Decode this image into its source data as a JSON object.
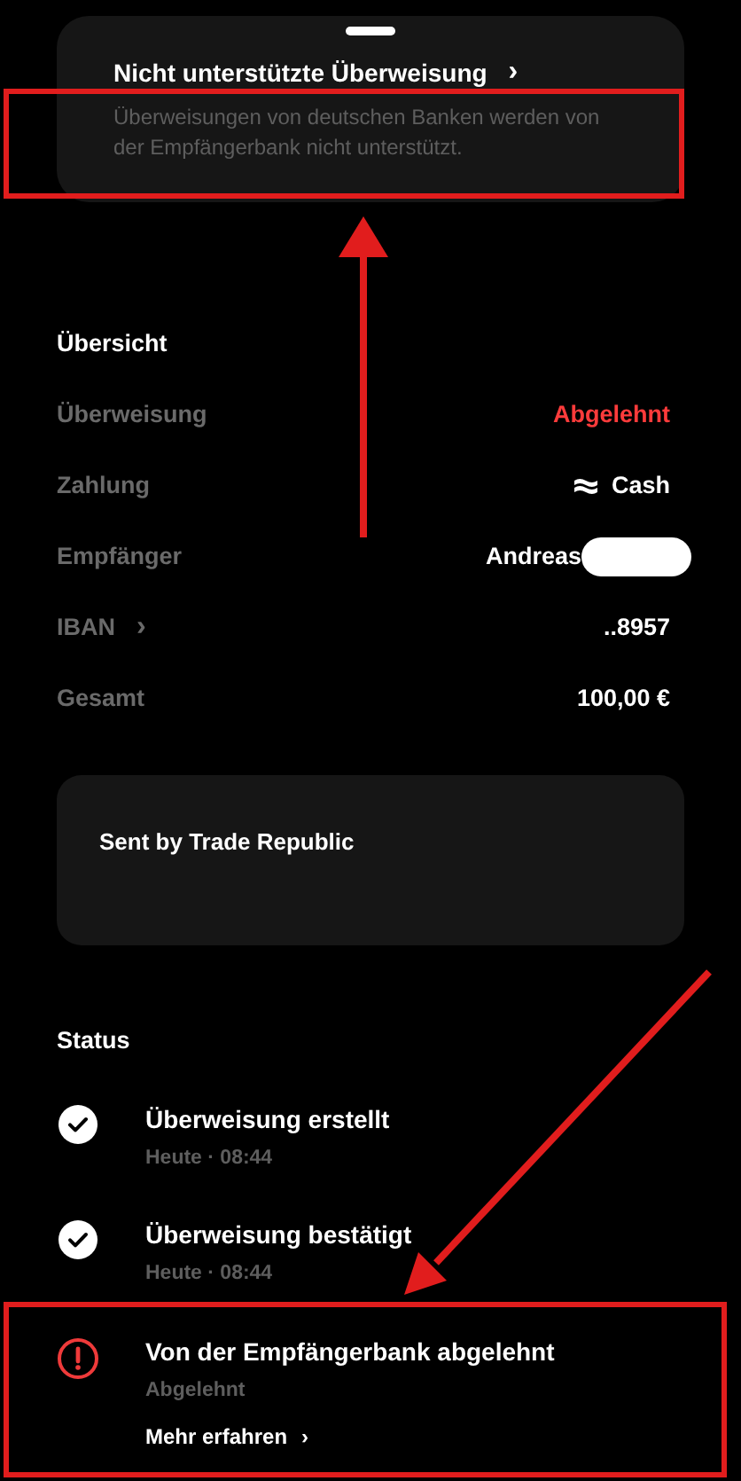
{
  "notice": {
    "title": "Nicht unterstützte Überweisung",
    "chevron": "›",
    "text": "Überweisungen von deutschen Banken werden von der Empfängerbank nicht unterstützt."
  },
  "overview": {
    "heading": "Übersicht",
    "rows": [
      {
        "kind": "status",
        "label": "Überweisung",
        "value": "Abgelehnt"
      },
      {
        "kind": "payment",
        "label": "Zahlung",
        "value": "Cash"
      },
      {
        "kind": "redacted",
        "label": "Empfänger",
        "value": "Andreas"
      },
      {
        "kind": "link",
        "label": "IBAN",
        "chevron": "›",
        "value": "..8957"
      },
      {
        "kind": "plain",
        "label": "Gesamt",
        "value": "100,00 €"
      }
    ]
  },
  "message": {
    "text": "Sent by Trade Republic"
  },
  "status": {
    "heading": "Status",
    "steps": [
      {
        "kind": "done",
        "title": "Überweisung erstellt",
        "subtitle": "Heute · 08:44"
      },
      {
        "kind": "done",
        "title": "Überweisung bestätigt",
        "subtitle": "Heute · 08:44"
      },
      {
        "kind": "error",
        "title": "Von der Empfängerbank abgelehnt",
        "subtitle": "Abgelehnt",
        "link": "Mehr erfahren",
        "chevron": "›"
      }
    ]
  }
}
